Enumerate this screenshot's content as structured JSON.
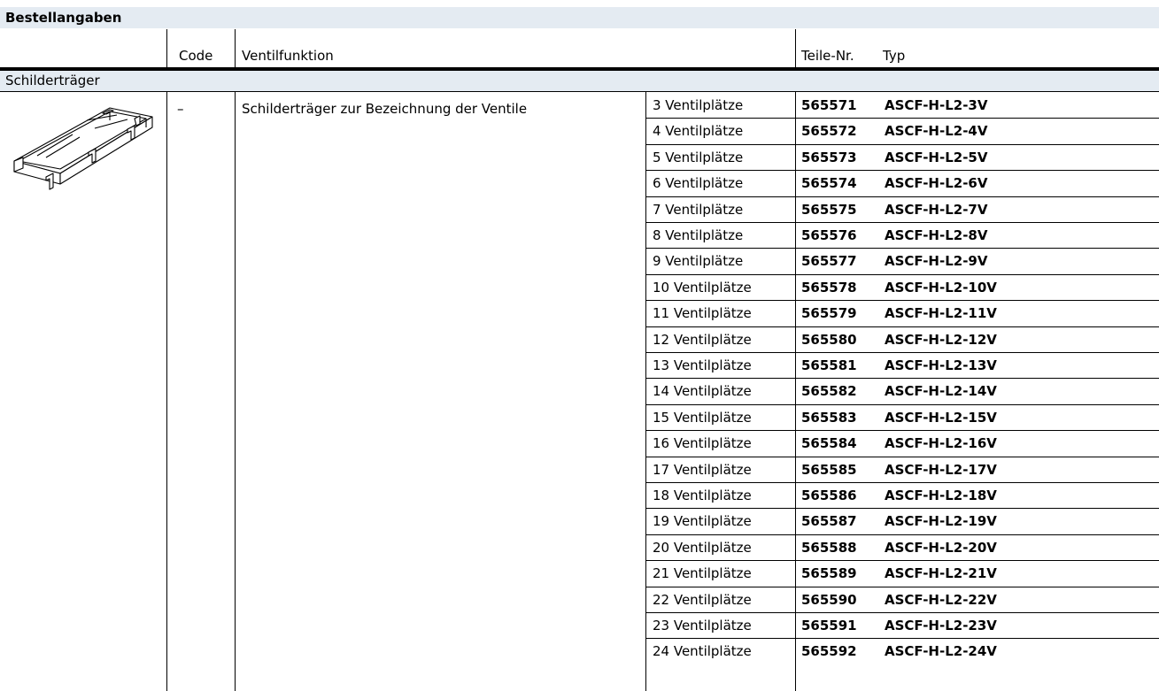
{
  "section_title": "Bestellangaben",
  "columns": {
    "code": "Code",
    "function": "Ventilfunktion",
    "part_no": "Teile-Nr.",
    "type": "Typ"
  },
  "group": {
    "title": "Schilderträger",
    "code_value": "–",
    "description": "Schilderträger zur Bezeichnung der Ventile",
    "image_icon": "sign-holder-drawing"
  },
  "rows": [
    {
      "variant": "3 Ventilplätze",
      "part_no": "565571",
      "type": "ASCF-H-L2-3V"
    },
    {
      "variant": "4 Ventilplätze",
      "part_no": "565572",
      "type": "ASCF-H-L2-4V"
    },
    {
      "variant": "5 Ventilplätze",
      "part_no": "565573",
      "type": "ASCF-H-L2-5V"
    },
    {
      "variant": "6 Ventilplätze",
      "part_no": "565574",
      "type": "ASCF-H-L2-6V"
    },
    {
      "variant": "7 Ventilplätze",
      "part_no": "565575",
      "type": "ASCF-H-L2-7V"
    },
    {
      "variant": "8 Ventilplätze",
      "part_no": "565576",
      "type": "ASCF-H-L2-8V"
    },
    {
      "variant": "9 Ventilplätze",
      "part_no": "565577",
      "type": "ASCF-H-L2-9V"
    },
    {
      "variant": "10 Ventilplätze",
      "part_no": "565578",
      "type": "ASCF-H-L2-10V"
    },
    {
      "variant": "11 Ventilplätze",
      "part_no": "565579",
      "type": "ASCF-H-L2-11V"
    },
    {
      "variant": "12 Ventilplätze",
      "part_no": "565580",
      "type": "ASCF-H-L2-12V"
    },
    {
      "variant": "13 Ventilplätze",
      "part_no": "565581",
      "type": "ASCF-H-L2-13V"
    },
    {
      "variant": "14 Ventilplätze",
      "part_no": "565582",
      "type": "ASCF-H-L2-14V"
    },
    {
      "variant": "15 Ventilplätze",
      "part_no": "565583",
      "type": "ASCF-H-L2-15V"
    },
    {
      "variant": "16 Ventilplätze",
      "part_no": "565584",
      "type": "ASCF-H-L2-16V"
    },
    {
      "variant": "17 Ventilplätze",
      "part_no": "565585",
      "type": "ASCF-H-L2-17V"
    },
    {
      "variant": "18 Ventilplätze",
      "part_no": "565586",
      "type": "ASCF-H-L2-18V"
    },
    {
      "variant": "19 Ventilplätze",
      "part_no": "565587",
      "type": "ASCF-H-L2-19V"
    },
    {
      "variant": "20 Ventilplätze",
      "part_no": "565588",
      "type": "ASCF-H-L2-20V"
    },
    {
      "variant": "21 Ventilplätze",
      "part_no": "565589",
      "type": "ASCF-H-L2-21V"
    },
    {
      "variant": "22 Ventilplätze",
      "part_no": "565590",
      "type": "ASCF-H-L2-22V"
    },
    {
      "variant": "23 Ventilplätze",
      "part_no": "565591",
      "type": "ASCF-H-L2-23V"
    },
    {
      "variant": "24 Ventilplätze",
      "part_no": "565592",
      "type": "ASCF-H-L2-24V"
    }
  ]
}
